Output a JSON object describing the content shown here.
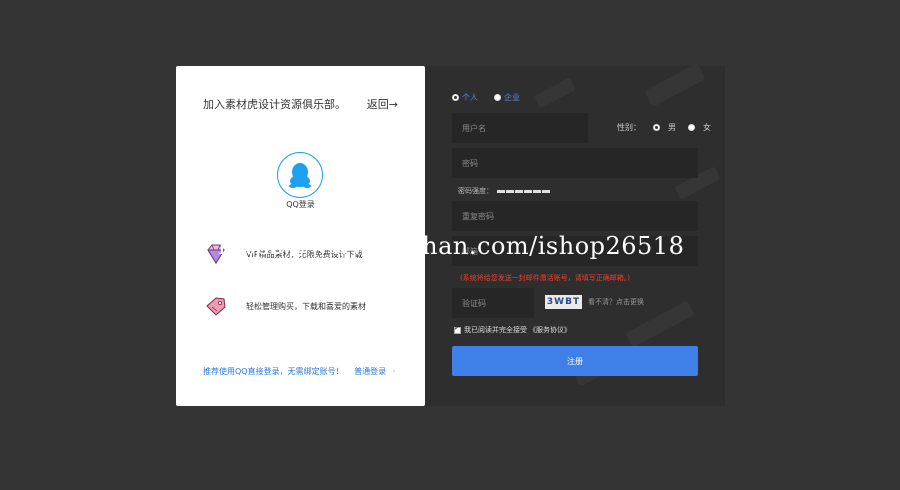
{
  "left": {
    "title": "加入素材虎设计资源俱乐部。",
    "back": "返回→",
    "qq_label": "QQ登录",
    "features": [
      {
        "text": "VIP精品素材，无限免费设计下载",
        "icon": "diamond-icon"
      },
      {
        "text": "轻松管理购买，下载和喜爱的素材",
        "icon": "price-tag-icon"
      }
    ],
    "links": {
      "qq_direct": "推荐使用QQ直接登录，无需绑定账号！",
      "normal_login": "普通登录",
      "dot": "·"
    }
  },
  "right": {
    "account_types": [
      "个人",
      "企业"
    ],
    "username_placeholder": "用户名",
    "gender_label": "性别：",
    "gender_options": [
      "男",
      "女"
    ],
    "password_placeholder": "密码",
    "strength_label": "密码强度：",
    "repeat_password_placeholder": "重复密码",
    "email_placeholder": "邮箱",
    "notice": "(系统将给您发送一封邮件激活账号，请填写正确邮箱。)",
    "captcha_placeholder": "验证码",
    "captcha_text": "3WBT",
    "refresh_text": "看不清？点击更换",
    "agree_text": "我已阅读并完全接受",
    "agree_link": "《服务协议》",
    "submit": "注册"
  },
  "watermark": "https://www.huzhan.com/ishop26518",
  "colors": {
    "page_bg": "#343434",
    "panel_dark": "#2e2e2e",
    "field_bg": "#262626",
    "accent_blue": "#3f7fe8",
    "qq_blue": "#1ea0f0",
    "notice_red": "#e8412e"
  }
}
